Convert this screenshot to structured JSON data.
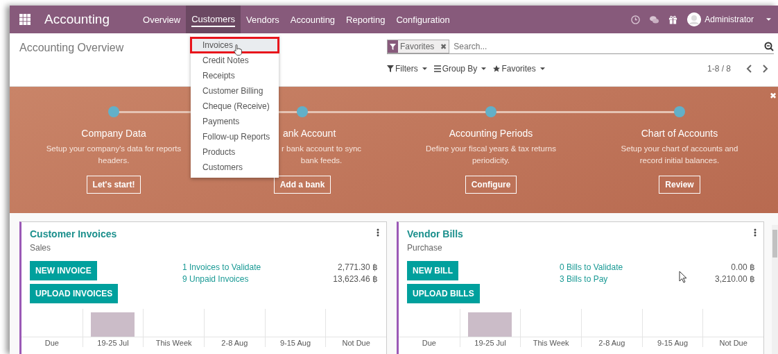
{
  "navbar": {
    "app_title": "Accounting",
    "menu": [
      {
        "label": "Overview",
        "selected": false
      },
      {
        "label": "Customers",
        "selected": true
      },
      {
        "label": "Vendors",
        "selected": false
      },
      {
        "label": "Accounting",
        "selected": false
      },
      {
        "label": "Reporting",
        "selected": false
      },
      {
        "label": "Configuration",
        "selected": false
      }
    ],
    "user": "Administrator"
  },
  "customers_menu": {
    "items": [
      {
        "label": "Invoices",
        "selected": true
      },
      {
        "label": "Credit Notes",
        "selected": false
      },
      {
        "label": "Receipts",
        "selected": false
      },
      {
        "label": "Customer Billing",
        "selected": false
      },
      {
        "label": "Cheque (Receive)",
        "selected": false
      },
      {
        "label": "Payments",
        "selected": false
      },
      {
        "label": "Follow-up Reports",
        "selected": false
      },
      {
        "label": "Products",
        "selected": false
      },
      {
        "label": "Customers",
        "selected": false
      }
    ]
  },
  "control_panel": {
    "breadcrumb": "Accounting Overview",
    "search": {
      "facet": "Favorites",
      "remove": "✖",
      "placeholder": "Search..."
    },
    "search_options": [
      "Filters",
      "Group By",
      "Favorites"
    ],
    "pager": "1-8 / 8"
  },
  "onboarding": {
    "close": "✖",
    "steps": [
      {
        "title": "Company Data",
        "description": "Setup your company's data for reports headers.",
        "button": "Let's start!",
        "covered": false
      },
      {
        "title": "ank Account",
        "description": "r bank account to sync\nbank feeds.",
        "button": "Add a bank",
        "covered": true
      },
      {
        "title": "Accounting Periods",
        "description": "Define your fiscal years & tax returns periodicity.",
        "button": "Configure",
        "covered": false
      },
      {
        "title": "Chart of Accounts",
        "description": "Setup your chart of accounts and record initial balances.",
        "button": "Review",
        "covered": false
      }
    ]
  },
  "journals": [
    {
      "title": "Customer Invoices",
      "subtitle": "Sales",
      "buttons": [
        "NEW INVOICE",
        "UPLOAD INVOICES"
      ],
      "links": [
        {
          "label": "1 Invoices to Validate",
          "amount": "2,771.30 ฿"
        },
        {
          "label": "9 Unpaid Invoices",
          "amount": "13,623.46 ฿"
        }
      ],
      "graph": [
        {
          "label": "Due",
          "filled": false
        },
        {
          "label": "19-25 Jul",
          "filled": true
        },
        {
          "label": "This Week",
          "filled": false
        },
        {
          "label": "2-8 Aug",
          "filled": false
        },
        {
          "label": "9-15 Aug",
          "filled": false
        },
        {
          "label": "Not Due",
          "filled": false
        }
      ]
    },
    {
      "title": "Vendor Bills",
      "subtitle": "Purchase",
      "buttons": [
        "NEW BILL",
        "UPLOAD BILLS"
      ],
      "links": [
        {
          "label": "0 Bills to Validate",
          "amount": "0.00 ฿"
        },
        {
          "label": "3 Bills to Pay",
          "amount": "3,210.00 ฿"
        }
      ],
      "graph": [
        {
          "label": "Due",
          "filled": false
        },
        {
          "label": "19-25 Jul",
          "filled": true
        },
        {
          "label": "This Week",
          "filled": false
        },
        {
          "label": "2-8 Aug",
          "filled": false
        },
        {
          "label": "9-15 Aug",
          "filled": false
        },
        {
          "label": "Not Due",
          "filled": false
        }
      ]
    }
  ]
}
